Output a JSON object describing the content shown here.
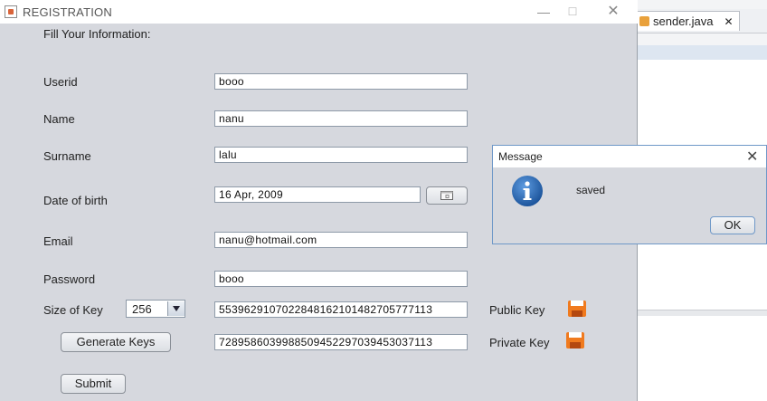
{
  "registration_window": {
    "title": "REGISTRATION",
    "controls": {
      "minimize": "—",
      "maximize": "☐",
      "close": "✕"
    },
    "heading": "Fill Your Information:",
    "fields": {
      "userid": {
        "label": "Userid",
        "value": "booo"
      },
      "name": {
        "label": "Name",
        "value": "nanu"
      },
      "surname": {
        "label": "Surname",
        "value": "lalu"
      },
      "dob": {
        "label": "Date of birth",
        "value": "16 Apr, 2009"
      },
      "email": {
        "label": "Email",
        "value": "nanu@hotmail.com"
      },
      "password": {
        "label": "Password",
        "value": "booo"
      }
    },
    "key_size": {
      "label": "Size of Key",
      "selected": "256"
    },
    "public_key": {
      "value": "5539629107022848162101482705777113",
      "label": "Public Key"
    },
    "private_key": {
      "value": "7289586039988509452297039453037113",
      "label": "Private Key"
    },
    "generate_button": "Generate Keys",
    "submit_button": "Submit"
  },
  "message_dialog": {
    "title": "Message",
    "close": "✕",
    "text": "saved",
    "ok_button": "OK"
  },
  "ide": {
    "tab_label": "sender.java",
    "tab_close": "✕"
  },
  "colors": {
    "window_bg": "#d6d8de",
    "info_icon": "#2f6db5",
    "floppy": "#f07a1e"
  },
  "icons": {
    "app": "java-cup-icon",
    "calendar": "calendar-icon",
    "save": "floppy-disk-icon",
    "info": "info-icon",
    "dropdown": "triangle-down-icon"
  }
}
